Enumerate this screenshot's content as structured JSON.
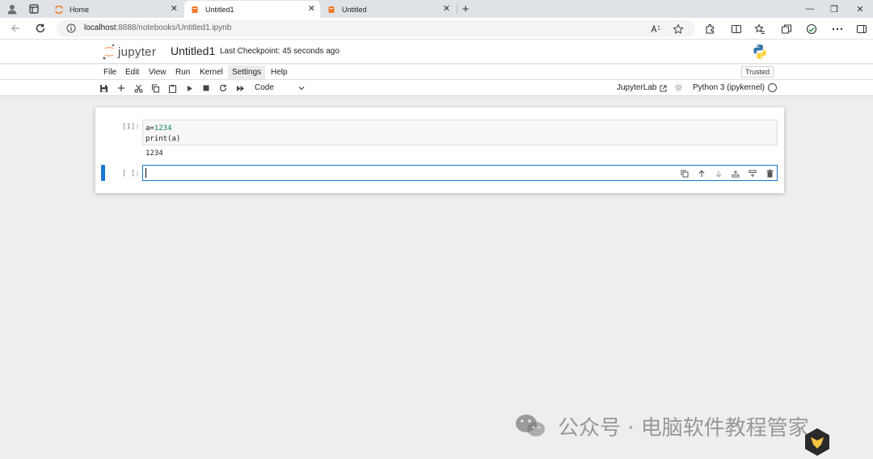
{
  "browser": {
    "tabs": [
      {
        "label": "Home"
      },
      {
        "label": "Untitled1"
      },
      {
        "label": "Untitled"
      }
    ],
    "new_tab_glyph": "+",
    "close_glyph": "✕",
    "window_controls": {
      "minimize": "—",
      "restore": "❐",
      "close": "✕"
    },
    "address": {
      "host": "localhost",
      "rest": ":8888/notebooks/Untitled1.ipynb"
    }
  },
  "jupyter": {
    "logo_text": "jupyter",
    "notebook_title": "Untitled1",
    "checkpoint": "Last Checkpoint: 45 seconds ago",
    "menu": [
      "File",
      "Edit",
      "View",
      "Run",
      "Kernel",
      "Settings",
      "Help"
    ],
    "trusted": "Trusted",
    "toolbar": {
      "cell_type": "Code",
      "jupyterlab_link": "JupyterLab",
      "kernel": "Python 3 (ipykernel)"
    },
    "cells": [
      {
        "prompt": "[1]:",
        "code": [
          "a=",
          "1234",
          "print(a)"
        ],
        "output": "1234"
      },
      {
        "prompt": "[ ]:"
      }
    ]
  },
  "watermark": {
    "text": "公众号 · 电脑软件教程管家"
  },
  "colors": {
    "accent": "#1976d2",
    "jupyter_orange": "#f37726",
    "number_green": "#098658"
  }
}
